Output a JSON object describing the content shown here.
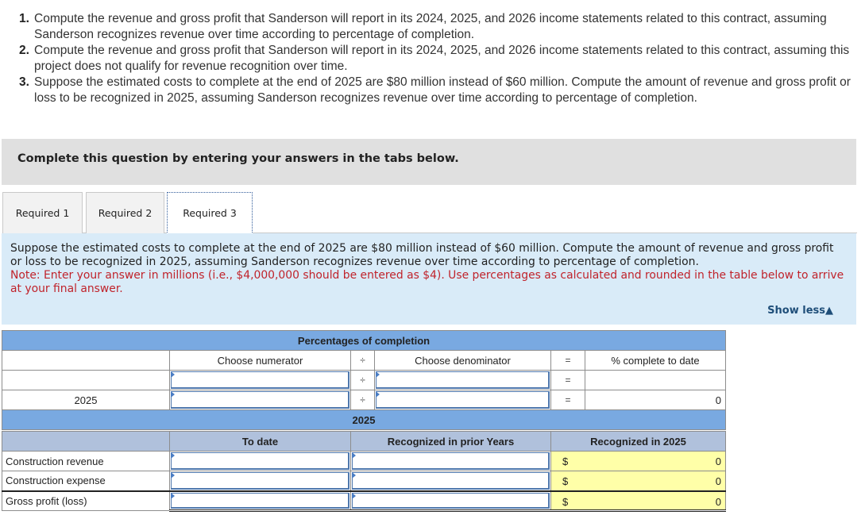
{
  "questions": [
    {
      "num": "1.",
      "text": "Compute the revenue and gross profit that Sanderson will report in its 2024, 2025, and 2026 income statements related to this contract, assuming Sanderson recognizes revenue over time according to percentage of completion."
    },
    {
      "num": "2.",
      "text": "Compute the revenue and gross profit that Sanderson will report in its 2024, 2025, and 2026 income statements related to this contract, assuming this project does not qualify for revenue recognition over time."
    },
    {
      "num": "3.",
      "text": "Suppose the estimated costs to complete at the end of 2025 are $80 million instead of $60 million. Compute the amount of revenue and gross profit or loss to be recognized in 2025, assuming Sanderson recognizes revenue over time according to percentage of completion."
    }
  ],
  "instruction": "Complete this question by entering your answers in the tabs below.",
  "tabs": [
    {
      "label": "Required 1",
      "active": false
    },
    {
      "label": "Required 2",
      "active": false
    },
    {
      "label": "Required 3",
      "active": true
    }
  ],
  "prompt": {
    "text": "Suppose the estimated costs to complete at the end of 2025 are $80 million instead of $60 million. Compute the amount of revenue and gross profit or loss to be recognized in 2025, assuming Sanderson recognizes revenue over time according to percentage of completion.",
    "note": "Note: Enter your answer in millions (i.e., $4,000,000 should be entered as $4). Use percentages as calculated and rounded in the table below to arrive at your final answer.",
    "show_less": "Show less",
    "show_less_icon": "triangle-up-icon"
  },
  "percent_table": {
    "title": "Percentages of completion",
    "headers": {
      "numerator": "Choose numerator",
      "divide": "÷",
      "denominator": "Choose denominator",
      "equals": "=",
      "result": "% complete to date"
    },
    "rows": [
      {
        "label": "",
        "numerator": "",
        "denominator": "",
        "result": ""
      },
      {
        "label": "2025",
        "numerator": "",
        "denominator": "",
        "result": "0"
      }
    ]
  },
  "income_table": {
    "year_header": "2025",
    "headers": {
      "to_date": "To date",
      "prior": "Recognized in prior Years",
      "current": "Recognized in 2025"
    },
    "rows": [
      {
        "label": "Construction revenue",
        "to_date": "",
        "prior": "",
        "currency": "$",
        "current": "0"
      },
      {
        "label": "Construction expense",
        "to_date": "",
        "prior": "",
        "currency": "$",
        "current": "0"
      },
      {
        "label": "Gross profit (loss)",
        "to_date": "",
        "prior": "",
        "currency": "$",
        "current": "0"
      }
    ]
  }
}
